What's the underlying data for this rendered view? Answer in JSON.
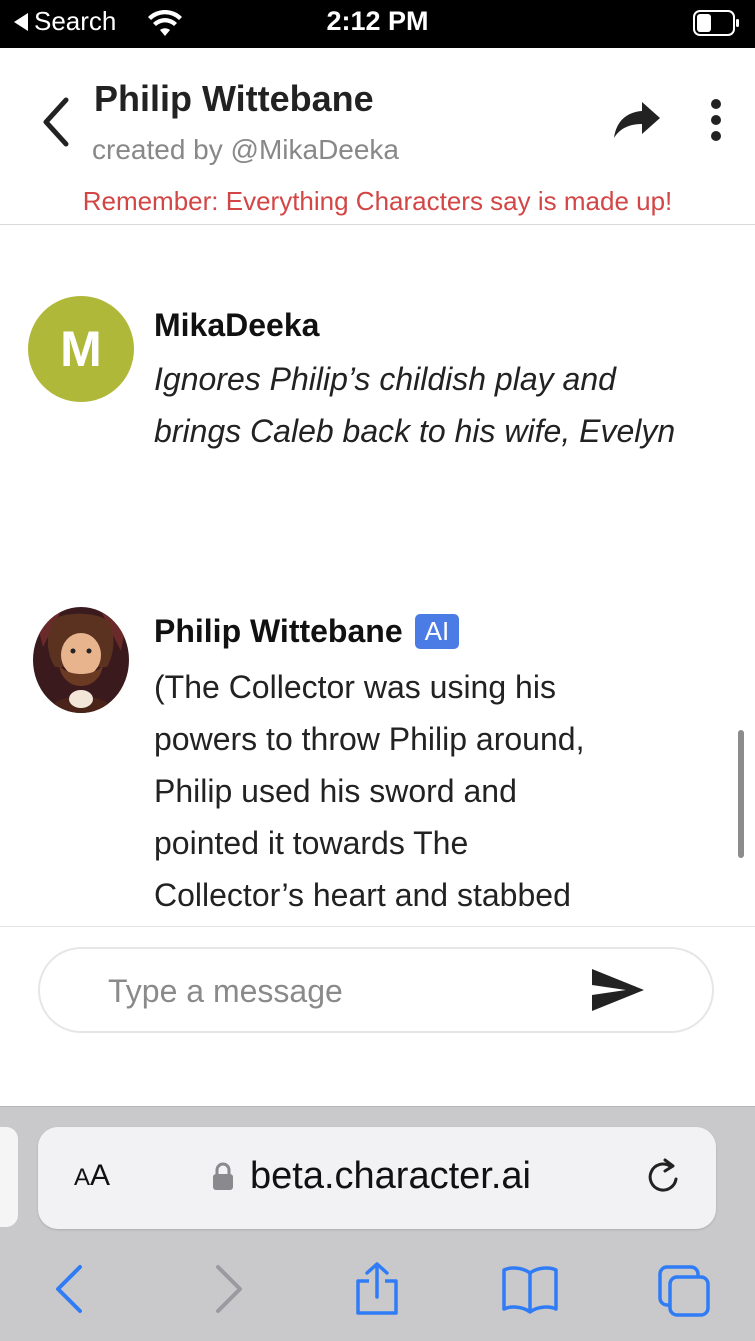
{
  "status_bar": {
    "back_label": "Search",
    "time": "2:12 PM"
  },
  "header": {
    "title": "Philip Wittebane",
    "subtitle": "created by @MikaDeeka",
    "warning": "Remember: Everything Characters say is made up!"
  },
  "messages": [
    {
      "author": "MikaDeeka",
      "avatar_initial": "M",
      "text": "Ignores Philip’s childish play and brings Caleb back to his wife, Evelyn"
    },
    {
      "author": "Philip Wittebane",
      "badge": "AI",
      "lines": [
        "(The Collector was using his",
        "powers to throw Philip around,",
        "Philip used his sword and",
        "pointed it towards The",
        "Collector’s heart and stabbed"
      ]
    }
  ],
  "composer": {
    "placeholder": "Type a message",
    "value": ""
  },
  "browser": {
    "text_size_label": {
      "big": "A",
      "small": "A"
    },
    "url": "beta.character.ai"
  },
  "colors": {
    "warning": "#d24646",
    "avatar_bg": "#b0b83a",
    "ai_badge": "#4b7be5",
    "safari_blue": "#2f7cf6"
  },
  "icons": [
    "wifi-icon",
    "battery-icon",
    "chevron-left-icon",
    "share-arrow-icon",
    "more-vertical-icon",
    "send-icon",
    "lock-icon",
    "reload-icon",
    "safari-back-icon",
    "safari-forward-icon",
    "safari-share-icon",
    "bookmarks-icon",
    "tabs-icon"
  ]
}
